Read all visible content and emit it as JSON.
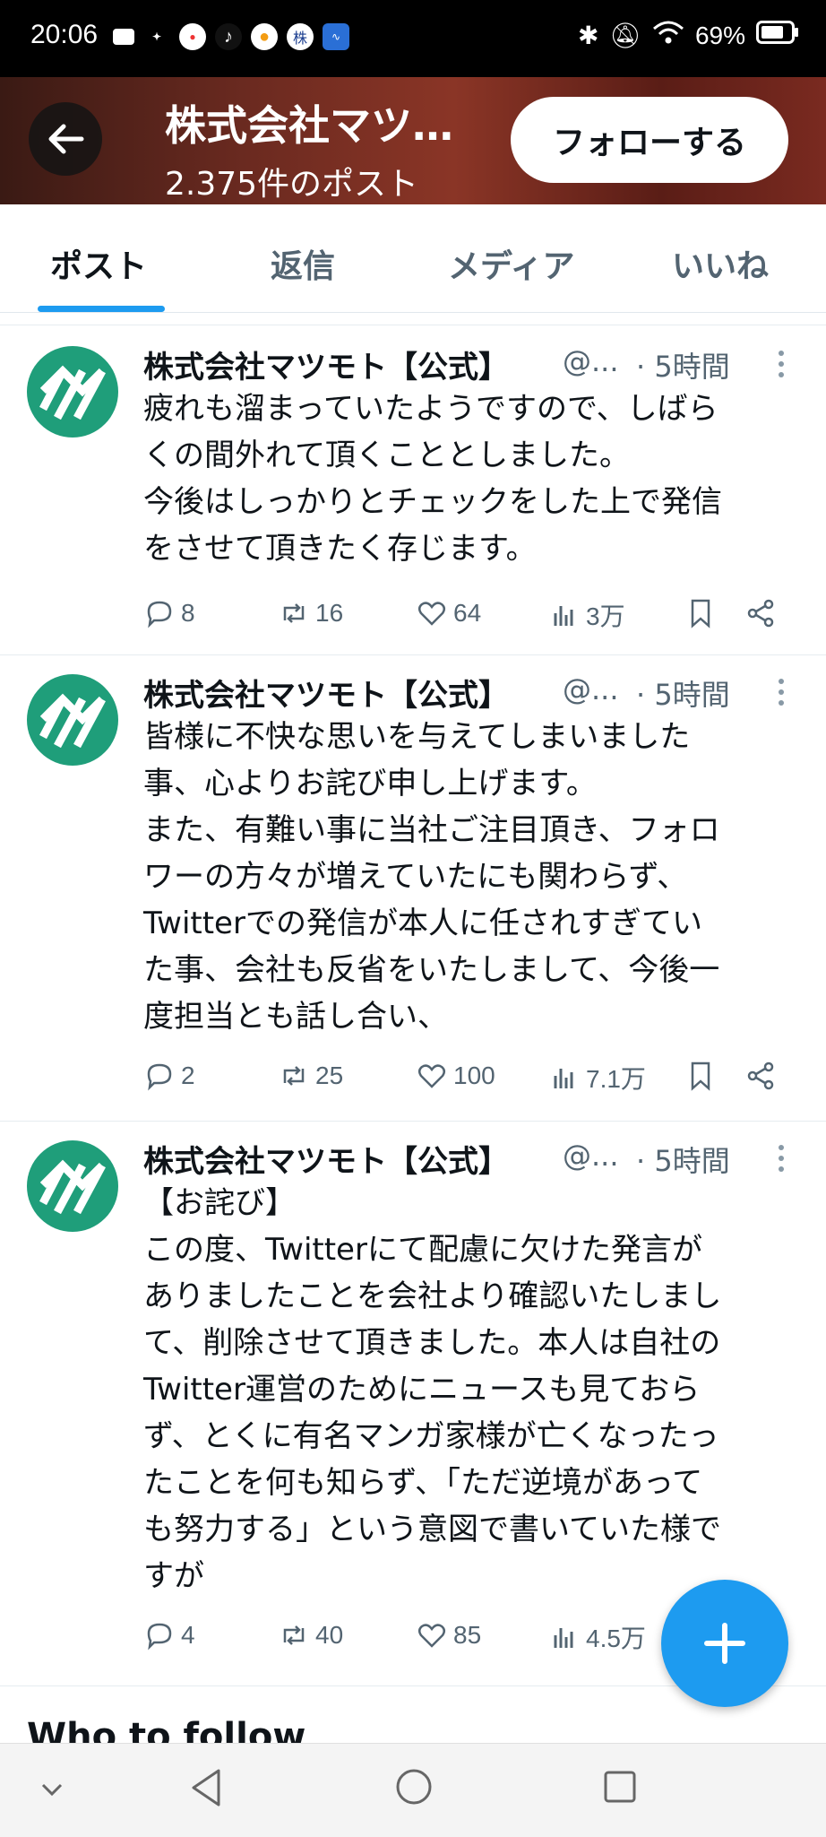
{
  "status_bar": {
    "time": "20:06",
    "battery": "69%",
    "app_icons": [
      "youtube",
      "sports",
      "news",
      "tiktok",
      "orange-app",
      "stock-app",
      "chart-app"
    ]
  },
  "header": {
    "title": "株式会社マツ…",
    "subtitle": "2.375件のポスト",
    "follow_label": "フォローする"
  },
  "tabs": [
    {
      "label": "ポスト",
      "active": true
    },
    {
      "label": "返信",
      "active": false
    },
    {
      "label": "メディア",
      "active": false
    },
    {
      "label": "いいね",
      "active": false
    }
  ],
  "posts": [
    {
      "name": "株式会社マツモト【公式】",
      "handle": "@...",
      "time": "· 5時間",
      "body": "疲れも溜まっていたようですので、しばら\nくの間外れて頂くこととしました。\n今後はしっかりとチェックをした上で発信\nをさせて頂きたく存じます。",
      "replies": "8",
      "reposts": "16",
      "likes": "64",
      "views": "3万"
    },
    {
      "name": "株式会社マツモト【公式】",
      "handle": "@...",
      "time": "· 5時間",
      "body": "皆様に不快な思いを与えてしまいました\n事、心よりお詫び申し上げます。\nまた、有難い事に当社ご注目頂き、フォロ\nワーの方々が増えていたにも関わらず、\nTwitterでの発信が本人に任されすぎてい\nた事、会社も反省をいたしまして、今後一\n度担当とも話し合い、",
      "replies": "2",
      "reposts": "25",
      "likes": "100",
      "views": "7.1万"
    },
    {
      "name": "株式会社マツモト【公式】",
      "handle": "@...",
      "time": "· 5時間",
      "body": "【お詫び】\nこの度、Twitterにて配慮に欠けた発言が\nありましたことを会社より確認いたしまし\nて、削除させて頂きました。本人は自社の\nTwitter運営のためにニュースも見ておら\nず、とくに有名マンガ家様が亡くなったっ\nたことを何も知らず、「ただ逆境があって\nも努力する」という意図で書いていた様で\nすが",
      "replies": "4",
      "reposts": "40",
      "likes": "85",
      "views": "4.5万"
    }
  ],
  "who_to_follow": "Who to follow",
  "colors": {
    "accent": "#1d9bf0",
    "avatar": "#1f9e7a",
    "muted": "#536471"
  }
}
